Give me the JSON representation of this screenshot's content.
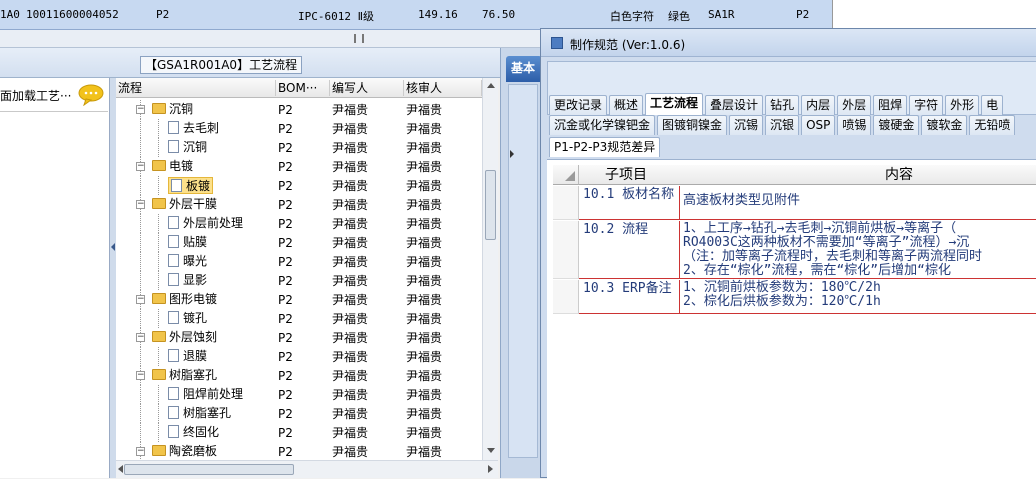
{
  "top_row": {
    "id": "1A0",
    "code": "10011600004052",
    "level": "P2",
    "material": "IPC-6012 Ⅱ级",
    "val1": "149.16",
    "val2": "76.50",
    "silkscreen": "白色字符",
    "solder_mask": "绿色",
    "sa": "SA1R",
    "level2": "P2"
  },
  "left_panel": {
    "title": "【GSA1R001A0】工艺流程",
    "side_text": "面加载工艺···"
  },
  "tree": {
    "columns": [
      "流程",
      "BOM···",
      "编写人",
      "核审人"
    ],
    "rows": [
      {
        "label": "沉铜",
        "type": "folder",
        "level": 1,
        "bom": "P2",
        "writer": "尹福贵",
        "reviewer": "尹福贵"
      },
      {
        "label": "去毛刺",
        "type": "doc",
        "level": 2,
        "bom": "P2",
        "writer": "尹福贵",
        "reviewer": "尹福贵"
      },
      {
        "label": "沉铜",
        "type": "doc",
        "level": 2,
        "bom": "P2",
        "writer": "尹福贵",
        "reviewer": "尹福贵"
      },
      {
        "label": "电镀",
        "type": "folder",
        "level": 1,
        "bom": "P2",
        "writer": "尹福贵",
        "reviewer": "尹福贵"
      },
      {
        "label": "板镀",
        "type": "doc",
        "level": 2,
        "bom": "P2",
        "writer": "尹福贵",
        "reviewer": "尹福贵",
        "selected": true
      },
      {
        "label": "外层干膜",
        "type": "folder",
        "level": 1,
        "bom": "P2",
        "writer": "尹福贵",
        "reviewer": "尹福贵"
      },
      {
        "label": "外层前处理",
        "type": "doc",
        "level": 2,
        "bom": "P2",
        "writer": "尹福贵",
        "reviewer": "尹福贵"
      },
      {
        "label": "贴膜",
        "type": "doc",
        "level": 2,
        "bom": "P2",
        "writer": "尹福贵",
        "reviewer": "尹福贵"
      },
      {
        "label": "曝光",
        "type": "doc",
        "level": 2,
        "bom": "P2",
        "writer": "尹福贵",
        "reviewer": "尹福贵"
      },
      {
        "label": "显影",
        "type": "doc",
        "level": 2,
        "bom": "P2",
        "writer": "尹福贵",
        "reviewer": "尹福贵"
      },
      {
        "label": "图形电镀",
        "type": "folder",
        "level": 1,
        "bom": "P2",
        "writer": "尹福贵",
        "reviewer": "尹福贵"
      },
      {
        "label": "镀孔",
        "type": "doc",
        "level": 2,
        "bom": "P2",
        "writer": "尹福贵",
        "reviewer": "尹福贵"
      },
      {
        "label": "外层蚀刻",
        "type": "folder",
        "level": 1,
        "bom": "P2",
        "writer": "尹福贵",
        "reviewer": "尹福贵"
      },
      {
        "label": "退膜",
        "type": "doc",
        "level": 2,
        "bom": "P2",
        "writer": "尹福贵",
        "reviewer": "尹福贵"
      },
      {
        "label": "树脂塞孔",
        "type": "folder",
        "level": 1,
        "bom": "P2",
        "writer": "尹福贵",
        "reviewer": "尹福贵"
      },
      {
        "label": "阻焊前处理",
        "type": "doc",
        "level": 2,
        "bom": "P2",
        "writer": "尹福贵",
        "reviewer": "尹福贵"
      },
      {
        "label": "树脂塞孔",
        "type": "doc",
        "level": 2,
        "bom": "P2",
        "writer": "尹福贵",
        "reviewer": "尹福贵"
      },
      {
        "label": "终固化",
        "type": "doc",
        "level": 2,
        "bom": "P2",
        "writer": "尹福贵",
        "reviewer": "尹福贵"
      },
      {
        "label": "陶瓷磨板",
        "type": "folder",
        "level": 1,
        "bom": "P2",
        "writer": "尹福贵",
        "reviewer": "尹福贵"
      }
    ]
  },
  "mid_panel": {
    "tab_label": "基本"
  },
  "dialog": {
    "title": "制作规范 (Ver:1.0.6)",
    "tabs_row1": [
      "更改记录",
      "概述",
      "工艺流程",
      "叠层设计",
      "钻孔",
      "内层",
      "外层",
      "阻焊",
      "字符",
      "外形",
      "电"
    ],
    "active_tab": "工艺流程",
    "tabs_row2": [
      "沉金或化学镍钯金",
      "图镀铜镍金",
      "沉锡",
      "沉银",
      "OSP",
      "喷锡",
      "镀硬金",
      "镀软金",
      "无铅喷"
    ],
    "tabs_row3": [
      "P1-P2-P3规范差异"
    ],
    "table": {
      "col_item": "子项目",
      "col_content": "内容",
      "rows": [
        {
          "item": "10.1 板材名称",
          "content": [
            "高速板材类型见附件"
          ]
        },
        {
          "item": "10.2 流程",
          "content": [
            "1、上工序→钻孔→去毛刺→沉铜前烘板→等离子（",
            "RO4003C这两种板材不需要加“等离子”流程）→沉",
            "（注：加等离子流程时，去毛刺和等离子两流程同时",
            "2、存在“棕化”流程，需在“棕化”后增加“棕化"
          ]
        },
        {
          "item": "10.3 ERP备注",
          "content": [
            "1、沉铜前烘板参数为：180℃/2h",
            "2、棕化后烘板参数为：120℃/1h"
          ]
        }
      ]
    }
  }
}
